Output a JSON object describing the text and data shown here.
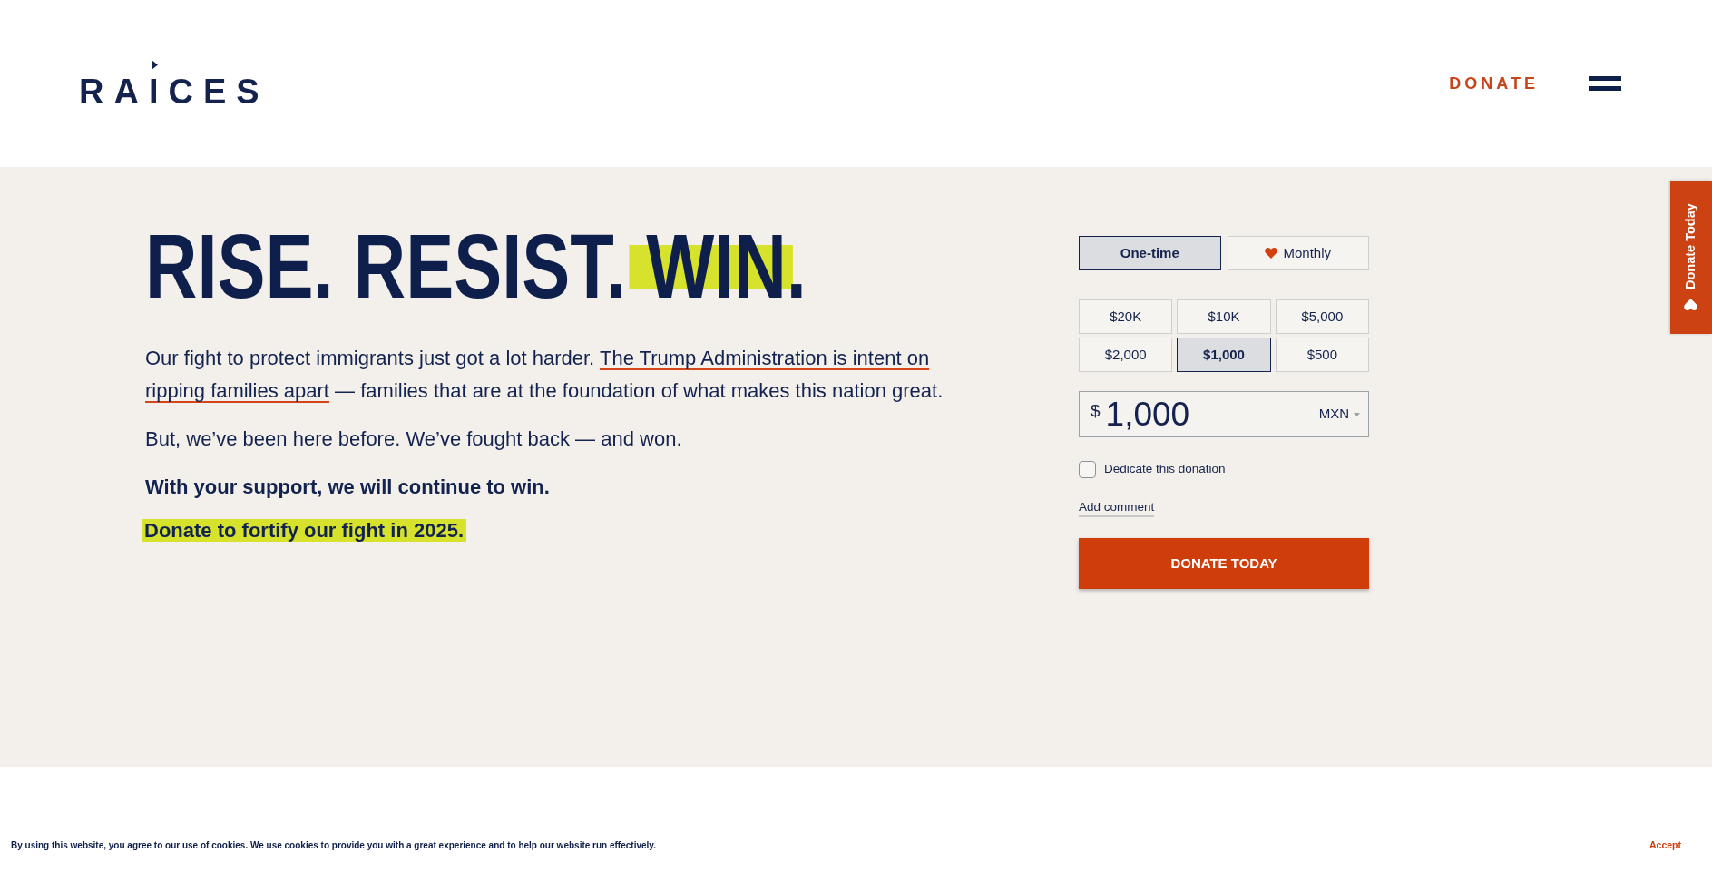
{
  "header": {
    "logo": "RAICES",
    "donate_link": "DONATE"
  },
  "hero": {
    "heading": [
      {
        "text": "RISE. RESIST.",
        "highlight": false
      },
      {
        "text": "WIN.",
        "highlight": true
      }
    ],
    "paragraphs": [
      {
        "kind": "plain",
        "parts": [
          {
            "text": "Our fight to protect immigrants just got a lot harder.",
            "underline": false
          },
          {
            "text": "The Trump Administration is intent on ripping families apart",
            "underline": true
          },
          {
            "text": "— families that are at the foundation of what makes this nation great.",
            "underline": false
          }
        ]
      },
      {
        "kind": "plain",
        "parts": [
          {
            "text": "But, we’ve been here before. We’ve fought back — and won.",
            "underline": false
          }
        ]
      },
      {
        "kind": "bold",
        "parts": [
          {
            "text": "With your support, we will continue to win.",
            "underline": false
          }
        ]
      },
      {
        "kind": "highlight",
        "parts": [
          {
            "text": "Donate to fortify our fight in 2025.",
            "underline": false
          }
        ]
      }
    ]
  },
  "donation_form": {
    "frequencies": [
      {
        "label": "One-time",
        "kind": "single",
        "selected": true
      },
      {
        "label": "Monthly",
        "kind": "recurring",
        "selected": false
      }
    ],
    "amounts": [
      {
        "label": "$20K",
        "selected": false
      },
      {
        "label": "$10K",
        "selected": false
      },
      {
        "label": "$5,000",
        "selected": false
      },
      {
        "label": "$2,000",
        "selected": false
      },
      {
        "label": "$1,000",
        "selected": true
      },
      {
        "label": "$500",
        "selected": false
      }
    ],
    "amount_field": {
      "symbol": "$",
      "value": "1,000",
      "currency": "MXN"
    },
    "dedicate": {
      "label": "Dedicate this donation",
      "checked": false
    },
    "comment_link": "Add comment",
    "submit": "DONATE TODAY"
  },
  "side_tab": {
    "label": "Donate Today"
  },
  "cookie_bar": {
    "message": "By using this website, you agree to our use of cookies. We use cookies to provide you with a great experience and to help our website run effectively.",
    "accept": "Accept"
  }
}
